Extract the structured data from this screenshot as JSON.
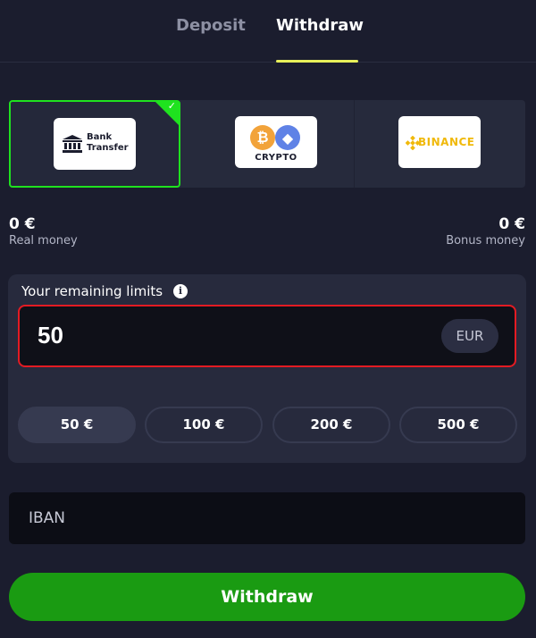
{
  "tabs": {
    "deposit": "Deposit",
    "withdraw": "Withdraw",
    "active": "withdraw"
  },
  "methods": [
    {
      "label_line1": "Bank",
      "label_line2": "Transfer",
      "icon": "bank-icon",
      "selected": true
    },
    {
      "label": "CRYPTO",
      "icon": "bitcoin-ethereum-icon",
      "btc_symbol": "₿",
      "eth_symbol": "◆",
      "selected": false
    },
    {
      "label": "BINANCE",
      "icon": "binance-icon",
      "selected": false
    }
  ],
  "balances": {
    "real_value": "0 €",
    "real_label": "Real money",
    "bonus_value": "0 €",
    "bonus_label": "Bonus money"
  },
  "limits": {
    "title": "Your remaining limits",
    "info_symbol": "i",
    "amount_value": "50",
    "currency": "EUR",
    "quick_amounts": [
      "50 €",
      "100 €",
      "200 €",
      "500 €"
    ],
    "selected_amount_index": 0
  },
  "iban": {
    "placeholder": "IBAN",
    "value": ""
  },
  "submit": {
    "label": "Withdraw"
  },
  "colors": {
    "background": "#1b1d2e",
    "panel": "#272a3d",
    "accent_tab": "#e8f05a",
    "selected_border": "#1fe21f",
    "error_border": "#e31b23",
    "button_green": "#1a9b12",
    "binance_gold": "#f0b90b",
    "btc_orange": "#f2a33a",
    "eth_blue": "#5f82e6"
  }
}
